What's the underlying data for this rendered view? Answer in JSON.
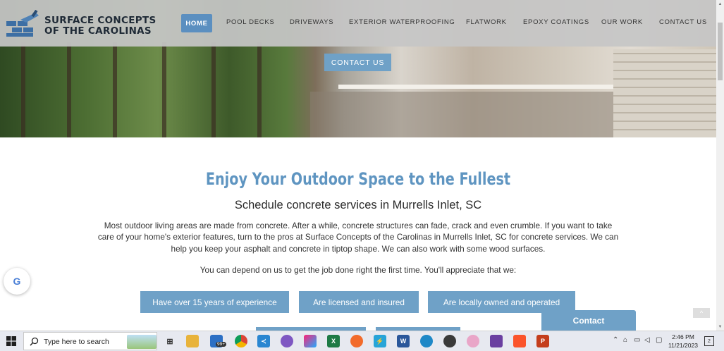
{
  "header": {
    "logo_line1": "SURFACE CONCEPTS",
    "logo_line2": "OF THE CAROLINAS",
    "nav": [
      "HOME",
      "POOL DECKS",
      "DRIVEWAYS",
      "EXTERIOR WATERPROOFING",
      "FLATWORK",
      "EPOXY COATINGS",
      "OUR WORK",
      "CONTACT US"
    ],
    "active": "HOME"
  },
  "hero": {
    "button_label": "CONTACT US"
  },
  "main": {
    "headline": "Enjoy Your Outdoor Space to the Fullest",
    "subheading": "Schedule concrete services in Murrells Inlet, SC",
    "paragraph": "Most outdoor living areas are made from concrete. After a while, concrete structures can fade, crack and even crumble. If you want to take care of your home's exterior features, turn to the pros at Surface Concepts of the Carolinas in Murrells Inlet, SC for concrete services. We can help you keep your asphalt and concrete in tiptop shape. We can also work with some wood surfaces.",
    "paragraph2": "You can depend on us to get the job done right the first time. You'll appreciate that we:",
    "pills": [
      "Have over 15 years of experience",
      "Are licensed and insured",
      "Are locally owned and operated"
    ]
  },
  "widgets": {
    "google_badge": "G",
    "contact_tab": "Contact",
    "scroll_top": "^"
  },
  "taskbar": {
    "search_placeholder": "Type here to search",
    "mail_badge": "99+",
    "time": "2:46 PM",
    "date": "11/21/2023",
    "notification_count": "2"
  },
  "colors": {
    "accent": "#6fa1c7",
    "nav_active": "#5b8fc0",
    "header_bg": "#c6c6c6"
  }
}
